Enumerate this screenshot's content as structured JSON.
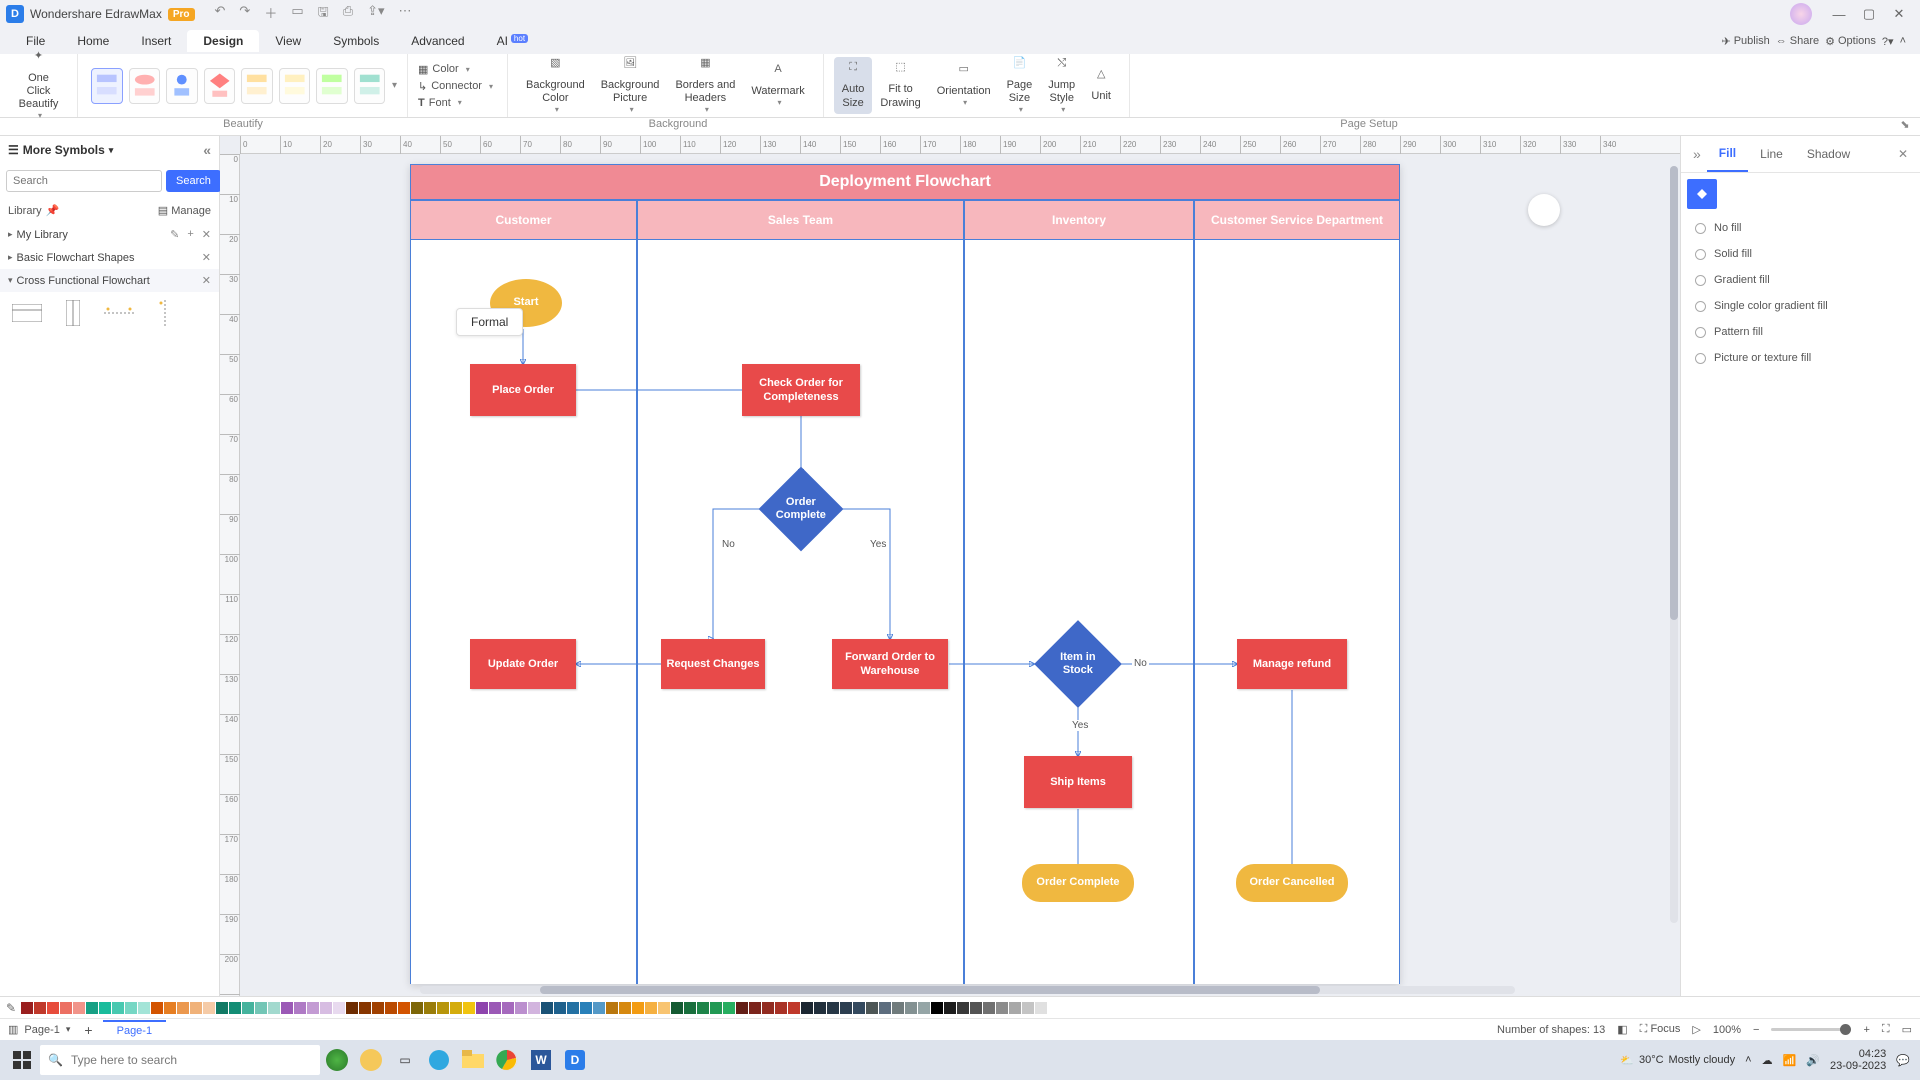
{
  "app": {
    "title": "Wondershare EdrawMax",
    "pro": "Pro"
  },
  "menubar": {
    "items": [
      "File",
      "Home",
      "Insert",
      "Design",
      "View",
      "Symbols",
      "Advanced",
      "AI"
    ],
    "active": "Design",
    "hot": "hot",
    "right": {
      "publish": "Publish",
      "share": "Share",
      "options": "Options"
    }
  },
  "ribbon": {
    "one_click": "One Click\nBeautify",
    "beautify_label": "Beautify",
    "props": {
      "color": "Color",
      "connector": "Connector",
      "font": "Font"
    },
    "bg_color": "Background\nColor",
    "bg_picture": "Background\nPicture",
    "borders": "Borders and\nHeaders",
    "watermark": "Watermark",
    "background_label": "Background",
    "auto_size": "Auto\nSize",
    "fit": "Fit to\nDrawing",
    "orientation": "Orientation",
    "page_size": "Page\nSize",
    "jump": "Jump\nStyle",
    "unit": "Unit",
    "page_setup_label": "Page Setup"
  },
  "left": {
    "header": "More Symbols",
    "search_placeholder": "Search",
    "search_btn": "Search",
    "library": "Library",
    "manage": "Manage",
    "my_library": "My Library",
    "sections": [
      {
        "name": "Basic Flowchart Shapes"
      },
      {
        "name": "Cross Functional Flowchart"
      }
    ]
  },
  "float_tag": "Formal",
  "flowchart": {
    "title": "Deployment Flowchart",
    "lanes": [
      "Customer",
      "Sales Team",
      "Inventory",
      "Customer Service Department"
    ],
    "shapes": {
      "start": "Start",
      "place_order": "Place Order",
      "check_order": "Check Order for Completeness",
      "order_complete": "Order Complete",
      "update_order": "Update Order",
      "request_changes": "Request Changes",
      "forward": "Forward Order to Warehouse",
      "item_in_stock": "Item in Stock",
      "ship": "Ship Items",
      "refund": "Manage refund",
      "end_complete": "Order Complete",
      "end_cancel": "Order Cancelled"
    },
    "labels": {
      "no": "No",
      "yes": "Yes"
    }
  },
  "right_panel": {
    "tabs": [
      "Fill",
      "Line",
      "Shadow"
    ],
    "active": "Fill",
    "options": [
      "No fill",
      "Solid fill",
      "Gradient fill",
      "Single color gradient fill",
      "Pattern fill",
      "Picture or texture fill"
    ]
  },
  "status": {
    "page_selector": "Page-1",
    "page_tab": "Page-1",
    "shapes": "Number of shapes: 13",
    "focus": "Focus",
    "zoom": "100%"
  },
  "taskbar": {
    "search": "Type here to search",
    "weather_temp": "30°C",
    "weather_text": "Mostly cloudy",
    "time": "04:23",
    "date": "23-09-2023"
  },
  "colors": [
    "#9a1f1f",
    "#c0392b",
    "#e74c3c",
    "#ec7063",
    "#f1948a",
    "#16a085",
    "#1abc9c",
    "#48c9b0",
    "#76d7c4",
    "#a3e4d7",
    "#d35400",
    "#e67e22",
    "#eb984e",
    "#f0b27a",
    "#f5cba7",
    "#117a65",
    "#138d75",
    "#45b39d",
    "#73c6b6",
    "#a2d9ce",
    "#9b59b6",
    "#af7ac5",
    "#c39bd3",
    "#d7bde2",
    "#e8daef",
    "#6e2c00",
    "#873600",
    "#a04000",
    "#ba4a00",
    "#d35400",
    "#7d6608",
    "#9a7d0a",
    "#b7950b",
    "#d4ac0d",
    "#f1c40f",
    "#8e44ad",
    "#9b59b6",
    "#a569bd",
    "#bb8fce",
    "#d2b4de",
    "#1a5276",
    "#1f618d",
    "#2471a3",
    "#2980b9",
    "#5499c7",
    "#b9770e",
    "#d68910",
    "#f39c12",
    "#f5b041",
    "#f8c471",
    "#145a32",
    "#196f3d",
    "#1e8449",
    "#229954",
    "#27ae60",
    "#641e16",
    "#7b241c",
    "#922b21",
    "#a93226",
    "#c0392b",
    "#1b2631",
    "#212f3c",
    "#273746",
    "#2c3e50",
    "#34495e",
    "#4d5656",
    "#5d6d7e",
    "#707b7c",
    "#839192",
    "#95a5a6",
    "#000000",
    "#1c1c1c",
    "#383838",
    "#545454",
    "#707070",
    "#8c8c8c",
    "#a8a8a8",
    "#c4c4c4",
    "#e0e0e0",
    "#ffffff"
  ]
}
